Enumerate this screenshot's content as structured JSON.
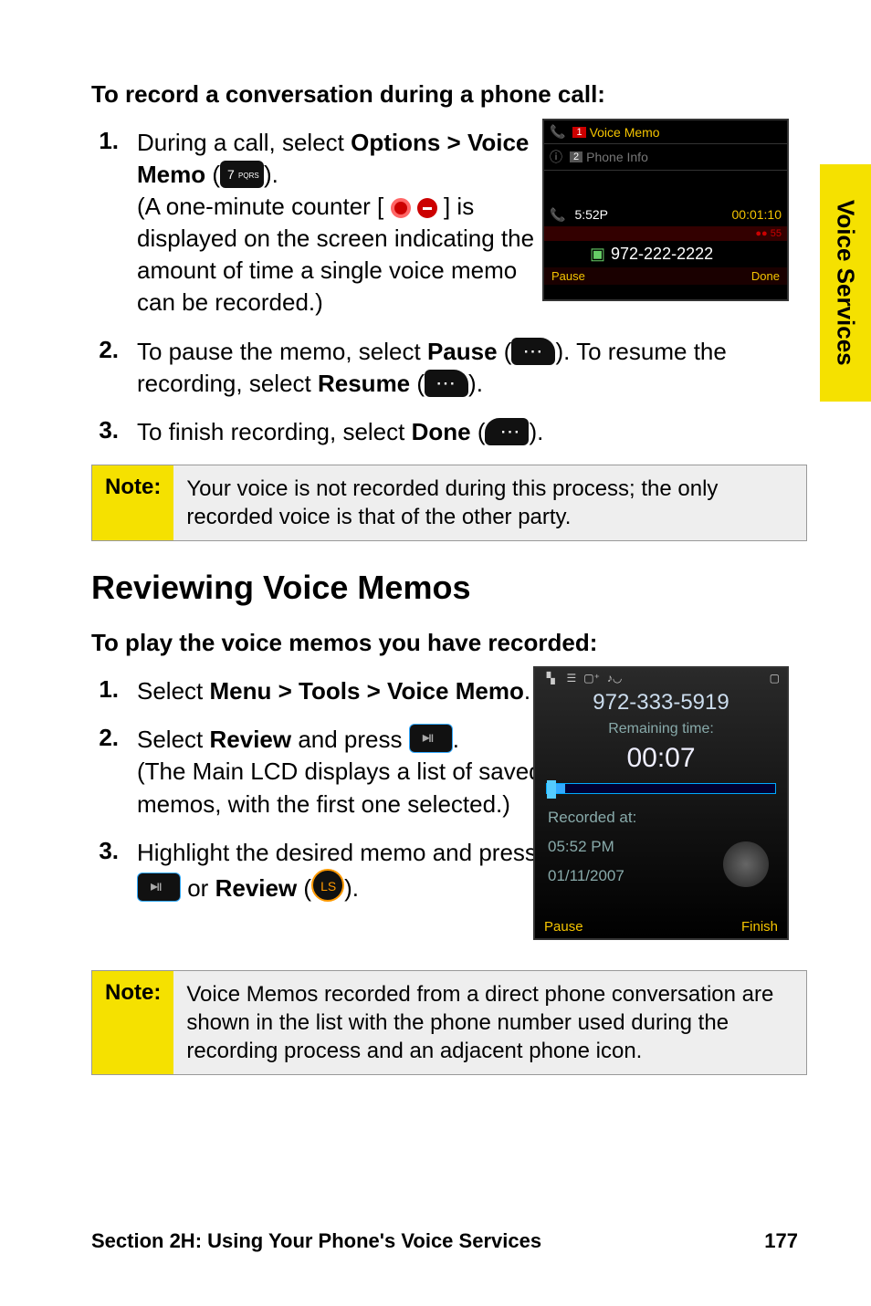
{
  "side_tab": "Voice Services",
  "section1": {
    "intro": "To record a conversation during a phone call:",
    "steps": [
      {
        "n": "1.",
        "parts": {
          "p1": "During a call, select ",
          "b1": "Options > Voice Memo",
          "p2": " (",
          "p3": ").",
          "p4": "(A one-minute counter [",
          "p5": "] is displayed on the screen indicating the amount of time a single voice memo can be recorded.)"
        }
      },
      {
        "n": "2.",
        "parts": {
          "p1": "To pause the memo, select ",
          "b1": "Pause",
          "p2": " (",
          "p3": "). To resume the recording, select ",
          "b2": "Resume",
          "p4": " (",
          "p5": ")."
        }
      },
      {
        "n": "3.",
        "parts": {
          "p1": "To finish recording, select ",
          "b1": "Done",
          "p2": " (",
          "p3": ")."
        }
      }
    ]
  },
  "note1": {
    "label": "Note:",
    "text": "Your voice is not recorded during this process; the only recorded voice is that of the other party."
  },
  "h2": "Reviewing Voice Memos",
  "section2": {
    "intro": "To play the voice memos you have recorded:",
    "steps": [
      {
        "n": "1.",
        "parts": {
          "p1": "Select ",
          "b1": "Menu > Tools > Voice Memo",
          "p2": "."
        }
      },
      {
        "n": "2.",
        "parts": {
          "p1": "Select ",
          "b1": "Review",
          "p2": " and press ",
          "p3": ".",
          "p4": "(The Main LCD displays a list of saved memos, with the first one selected.)"
        }
      },
      {
        "n": "3.",
        "parts": {
          "p1": "Highlight the desired memo and press ",
          "p2": " or ",
          "b1": "Review",
          "p3": " (",
          "p4": ")."
        }
      }
    ]
  },
  "note2": {
    "label": "Note:",
    "text": "Voice Memos recorded from a direct phone conversation are shown in the list with the phone number used during the recording process and an adjacent phone icon."
  },
  "screenshot1": {
    "tab1_num": "1",
    "tab1": "Voice Memo",
    "tab2_num": "2",
    "tab2": "Phone Info",
    "time": "5:52P",
    "elapsed": "00:01:10",
    "barR": "55",
    "phone": "972-222-2222",
    "footL": "Pause",
    "footR": "Done"
  },
  "screenshot2": {
    "number": "972-333-5919",
    "sub": "Remaining time:",
    "timer": "00:07",
    "meta1": "Recorded at:",
    "meta2": "05:52 PM",
    "meta3": "01/11/2007",
    "footL": "Pause",
    "footR": "Finish"
  },
  "footer": {
    "left": "Section 2H: Using Your Phone's Voice Services",
    "right": "177"
  }
}
